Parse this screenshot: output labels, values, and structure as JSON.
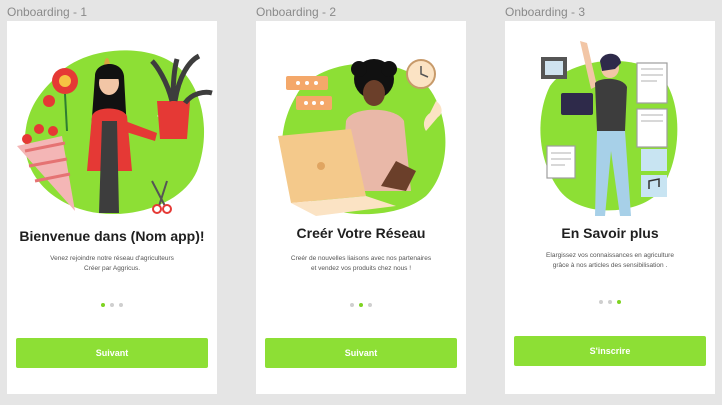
{
  "screens": [
    {
      "frame_label": "Onboarding - 1",
      "title": "Bienvenue dans (Nom app)!",
      "subtitle_lines": [
        "Venez rejoindre notre réseau d'agriculteurs",
        "Créer par Aggricus."
      ],
      "button_label": "Suivant",
      "active_dot": 1
    },
    {
      "frame_label": "Onboarding - 2",
      "title": "Creér Votre Réseau",
      "subtitle_lines": [
        "Creér de nouvelles liaisons avec nos partenaires",
        "et vendez vos produits chez nous !"
      ],
      "button_label": "Suivant",
      "active_dot": 2
    },
    {
      "frame_label": "Onboarding - 3",
      "title": "En Savoir plus",
      "subtitle_lines": [
        "Elargissez vos connaissances en agriculture",
        "grâce à nos articles des sensibilisation ."
      ],
      "button_label": "S'inscrire",
      "active_dot": 3
    }
  ],
  "colors": {
    "accent": "#8ddf35",
    "blob": "#8ddf35",
    "dot_active": "#7ed321",
    "dot_inactive": "#cfcfcf",
    "canvas_bg": "#e5e5e5",
    "card_bg": "#ffffff"
  }
}
